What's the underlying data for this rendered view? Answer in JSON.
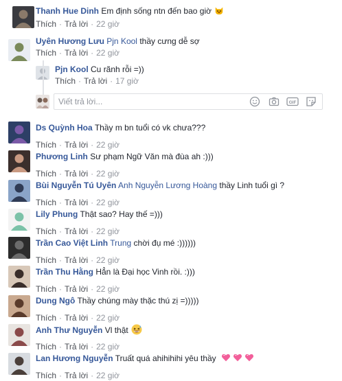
{
  "actions": {
    "like": "Thích",
    "reply": "Trả lời",
    "sep": "·"
  },
  "comments": [
    {
      "name": "Thanh Hue Dinh",
      "tag": "",
      "text": "Em định sống ntn đến bao giờ",
      "time": "22 giờ",
      "emoji": "laughing-cat-icon"
    },
    {
      "name": "Uyên Hương Lưu",
      "tag": "Pjn Kool",
      "text": "thầy cưng dễ sợ",
      "time": "22 giờ"
    },
    {
      "name": "Pjn Kool",
      "tag": "",
      "text": "Cu rãnh rỗi =))",
      "time": "17 giờ"
    },
    {
      "name": "Ds Quỳnh Hoa",
      "tag": "",
      "text": "Thầy m bn tuổi có vk chưa???",
      "time": "22 giờ"
    },
    {
      "name": "Phương Linh",
      "tag": "",
      "text": "Sư phạm Ngữ Văn mà đùa ah :)))",
      "time": "22 giờ"
    },
    {
      "name": "Bùi Nguyễn Tú Uyên",
      "tag": "Anh Nguyễn Lương Hoàng",
      "text": "thầy Linh tuổi gì ?",
      "time": "22 giờ"
    },
    {
      "name": "Lily Phung",
      "tag": "",
      "text": "Thật sao? Hay thế =)))",
      "time": "22 giờ"
    },
    {
      "name": "Trần Cao Việt Linh",
      "tag": "Trung",
      "text": "chời đụ mé :))))))",
      "time": "22 giờ"
    },
    {
      "name": "Trần Thu Hằng",
      "tag": "",
      "text": "Hẳn là Đại học Vinh rồi. :)))",
      "time": "22 giờ"
    },
    {
      "name": "Dung Ngô",
      "tag": "",
      "text": "Thầy chúng mày thặc thú zị =)))))",
      "time": "22 giờ"
    },
    {
      "name": "Anh Thư Nguyễn",
      "tag": "",
      "text": "Vl thật",
      "time": "22 giờ",
      "emoji": "grinning-sweat-icon"
    },
    {
      "name": "Lan Hương Nguyễn",
      "tag": "",
      "text": "Truất quá ahihihihi yêu thầy",
      "time": "22 giờ",
      "emoji": "hearts-icon"
    }
  ],
  "reply_box": {
    "placeholder": "Viết trả lời..."
  }
}
